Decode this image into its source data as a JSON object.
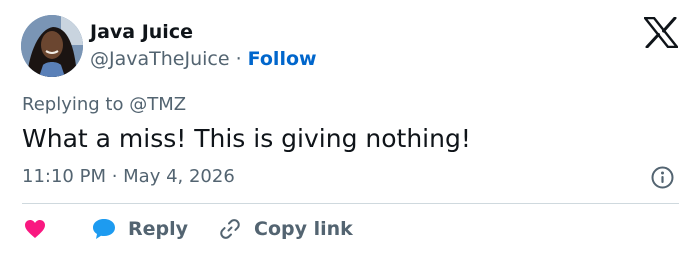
{
  "author": {
    "name": "Java Juice",
    "handle": "@JavaTheJuice",
    "separator": "·",
    "follow_label": "Follow"
  },
  "tweet": {
    "replying_to": "Replying to @TMZ",
    "text": "What a miss! This is giving nothing!",
    "timestamp": "11:10 PM · May 4, 2026"
  },
  "actions": {
    "reply_label": "Reply",
    "copy_link_label": "Copy link"
  },
  "icons": {
    "logo": "x-logo-icon",
    "info": "info-icon",
    "like": "heart-icon",
    "reply": "reply-bubble-icon",
    "copy": "link-icon"
  },
  "colors": {
    "follow": "#0066cc",
    "like": "#f91880",
    "reply": "#1d9bf0",
    "muted": "#536471",
    "text": "#0f1419"
  }
}
